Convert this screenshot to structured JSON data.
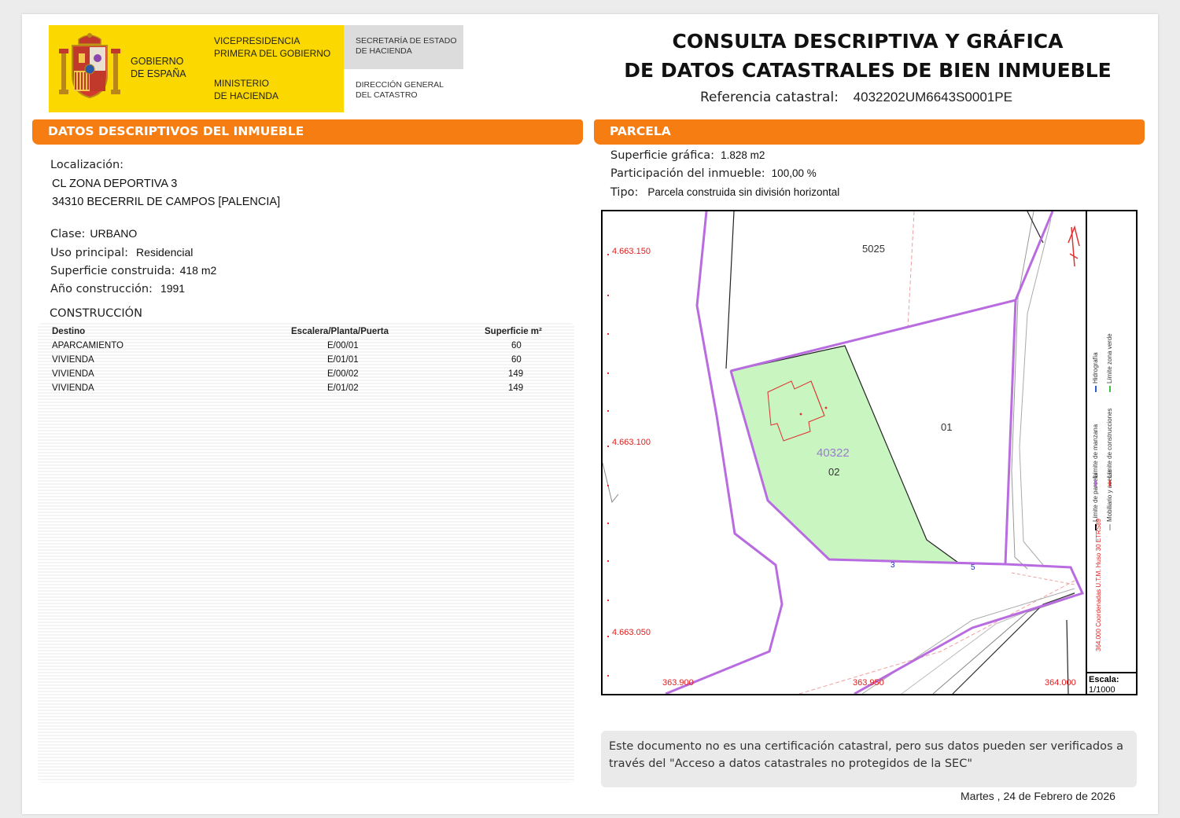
{
  "header": {
    "gobierno": [
      "GOBIERNO",
      "DE ESPAÑA"
    ],
    "vicepresidencia": [
      "VICEPRESIDENCIA",
      "PRIMERA DEL GOBIERNO"
    ],
    "ministerio": [
      "MINISTERIO",
      "DE HACIENDA"
    ],
    "secretaria": [
      "SECRETARÍA DE ESTADO",
      "DE HACIENDA"
    ],
    "direccion": [
      "DIRECCIÓN GENERAL",
      "DEL CATASTRO"
    ],
    "title_line1": "CONSULTA DESCRIPTIVA Y GRÁFICA",
    "title_line2": "DE DATOS CATASTRALES DE BIEN INMUEBLE",
    "ref_label": "Referencia catastral:",
    "ref_value": "4032202UM6643S0001PE"
  },
  "left": {
    "section_title": "DATOS DESCRIPTIVOS DEL INMUEBLE",
    "loc_label": "Localización:",
    "loc_line1": "CL ZONA DEPORTIVA 3",
    "loc_line2": "34310 BECERRIL DE CAMPOS [PALENCIA]",
    "clase_label": "Clase:",
    "clase_value": "URBANO",
    "uso_label": "Uso principal:",
    "uso_value": "Residencial",
    "sup_label": "Superficie construida:",
    "sup_value": "418 m2",
    "anio_label": "Año construcción:",
    "anio_value": "1991",
    "constr_title": "CONSTRUCCIÓN",
    "table": {
      "headers": [
        "Destino",
        "Escalera/Planta/Puerta",
        "Superficie m²"
      ],
      "rows": [
        [
          "APARCAMIENTO",
          "E/00/01",
          "60"
        ],
        [
          "VIVIENDA",
          "E/01/01",
          "60"
        ],
        [
          "VIVIENDA",
          "E/00/02",
          "149"
        ],
        [
          "VIVIENDA",
          "E/01/02",
          "149"
        ]
      ]
    }
  },
  "right": {
    "section_title": "PARCELA",
    "supg_label": "Superficie gráfica:",
    "supg_value": "1.828 m2",
    "part_label": "Participación del inmueble:",
    "part_value": "100,00 %",
    "tipo_label": "Tipo:",
    "tipo_value": "Parcela construida sin división horizontal"
  },
  "map": {
    "y_labels": [
      "4.663.150",
      "4.663.100",
      "4.663.050"
    ],
    "x_labels": [
      "363.900",
      "363.950",
      "364.000"
    ],
    "parcel_labels": [
      "5025",
      "01",
      "40322",
      "02",
      "3",
      "5"
    ],
    "legend": [
      "Hidrografía",
      "Límite zona verde",
      "Límite de parcela",
      "Mobiliario y aceras",
      "Límite de manzana",
      "Límite de construcciones"
    ],
    "coord_note": "364.000 Coordenadas U.T.M. Huso 30 ETRS89",
    "scale_label": "Escala:",
    "scale_value": "1/1000",
    "colors": {
      "manzana": "#b86ce0",
      "parcela": "#222222",
      "green": "#c8f5c0",
      "construction": "#e03030",
      "coord": "#e02020"
    }
  },
  "note": {
    "line1": "Este documento no es una certificación catastral, pero sus datos pueden ser verificados a",
    "line2": "través del \"Acceso a datos catastrales no protegidos de la SEC\""
  },
  "footer_date": "Martes , 24 de Febrero de 2026"
}
